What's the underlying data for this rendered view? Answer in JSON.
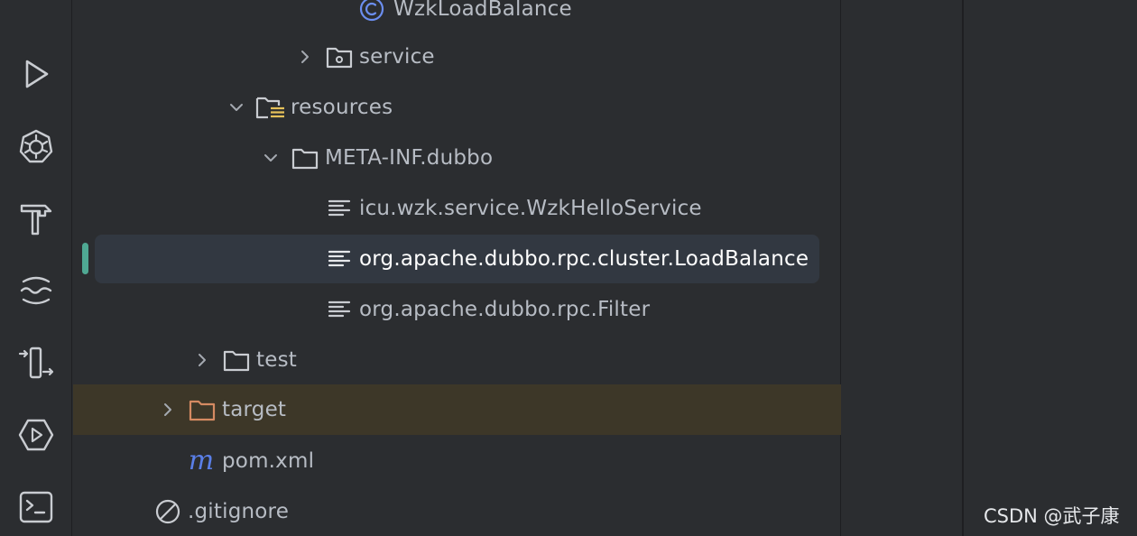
{
  "sidebar": {
    "tools": [
      {
        "icon": "run-icon"
      },
      {
        "icon": "kubernetes-icon"
      },
      {
        "icon": "build-icon"
      },
      {
        "icon": "services-icon"
      },
      {
        "icon": "commit-icon"
      },
      {
        "icon": "endpoints-icon"
      },
      {
        "icon": "terminal-icon"
      }
    ]
  },
  "tree": {
    "items": [
      {
        "label": "WzkLoadBalance",
        "icon": "class-icon"
      },
      {
        "label": "service",
        "icon": "package-folder-icon",
        "expanded": false
      },
      {
        "label": "resources",
        "icon": "resources-folder-icon",
        "expanded": true
      },
      {
        "label": "META-INF.dubbo",
        "icon": "folder-icon",
        "expanded": true
      },
      {
        "label": "icu.wzk.service.WzkHelloService",
        "icon": "text-file-icon"
      },
      {
        "label": "org.apache.dubbo.rpc.cluster.LoadBalance",
        "icon": "text-file-icon",
        "selected": true
      },
      {
        "label": "org.apache.dubbo.rpc.Filter",
        "icon": "text-file-icon"
      },
      {
        "label": "test",
        "icon": "folder-icon",
        "expanded": false
      },
      {
        "label": "target",
        "icon": "excluded-folder-icon",
        "expanded": false
      },
      {
        "label": "pom.xml",
        "icon": "maven-icon"
      },
      {
        "label": ".gitignore",
        "icon": "ignored-file-icon"
      }
    ]
  },
  "colors": {
    "background": "#2b2d30",
    "selection": "#323841",
    "selection_marker": "#4fa893",
    "excluded_row": "#3d3728",
    "text": "#b7bcc4",
    "class_icon": "#6b8ef0",
    "maven_icon": "#5a7fe8",
    "excluded_folder": "#d58a62"
  },
  "watermark": {
    "text": "CSDN @武子康"
  }
}
